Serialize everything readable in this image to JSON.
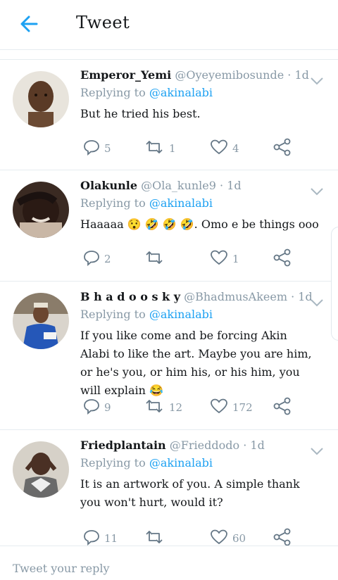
{
  "header": {
    "title": "Tweet"
  },
  "colors": {
    "accent": "#1da1f2",
    "muted": "#8899a6",
    "text": "#14171a"
  },
  "tweets": [
    {
      "name": "Emperor_Yemi",
      "handle": "@Oyeyemibosunde",
      "dot": "·",
      "time": "1d",
      "replying_label": "Replying to",
      "mention": "@akinalabi",
      "text": "But he tried his best.",
      "replies": "5",
      "retweets": "1",
      "likes": "4"
    },
    {
      "name": "Olakunle",
      "handle": "@Ola_kunle9",
      "dot": "·",
      "time": "1d",
      "replying_label": "Replying to",
      "mention": "@akinalabi",
      "text": "Haaaaa 😯 🤣 🤣 🤣. Omo e be things ooo",
      "replies": "2",
      "retweets": "",
      "likes": "1"
    },
    {
      "name": "B h a d o o s k y",
      "handle": "@BhadmusAkeem",
      "dot": "·",
      "time": "1d",
      "replying_label": "Replying to",
      "mention": "@akinalabi",
      "text": "If you like come and be forcing Akin Alabi to like the art. Maybe you are him, or he's you, or him his, or his him, you will explain 😂",
      "replies": "9",
      "retweets": "12",
      "likes": "172"
    },
    {
      "name": "Friedplantain",
      "handle": "@Frieddodo",
      "dot": "·",
      "time": "1d",
      "replying_label": "Replying to",
      "mention": "@akinalabi",
      "text": "It is an artwork of you. A simple thank you won't hurt, would it?",
      "replies": "11",
      "retweets": "",
      "likes": "60"
    }
  ],
  "reply_bar": {
    "placeholder": "Tweet your reply"
  }
}
